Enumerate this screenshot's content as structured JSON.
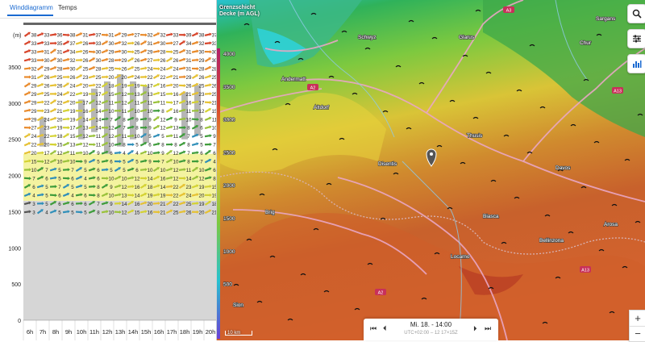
{
  "tabs": {
    "wind": "Winddiagramm",
    "temps": "Temps"
  },
  "unit": "(m)",
  "y_ticks": [
    "3500",
    "3000",
    "2500",
    "2000",
    "1500",
    "1000",
    "500",
    "0"
  ],
  "hours": [
    "6h",
    "7h",
    "8h",
    "9h",
    "10h",
    "11h",
    "12h",
    "13h",
    "14h",
    "15h",
    "16h",
    "17h",
    "18h",
    "19h",
    "20h"
  ],
  "rows": [
    [
      "38",
      "33",
      "36",
      "38",
      "31",
      "37",
      "31",
      "29",
      "27",
      "32",
      "32",
      "33",
      "39",
      "38",
      "37"
    ],
    [
      "33",
      "33",
      "35",
      "37",
      "26",
      "33",
      "30",
      "32",
      "26",
      "31",
      "30",
      "27",
      "34",
      "32",
      "33"
    ],
    [
      "33",
      "31",
      "31",
      "34",
      "26",
      "30",
      "29",
      "30",
      "25",
      "29",
      "28",
      "25",
      "31",
      "30",
      "30"
    ],
    [
      "33",
      "30",
      "30",
      "32",
      "26",
      "30",
      "28",
      "29",
      "26",
      "27",
      "26",
      "26",
      "31",
      "29",
      "30"
    ],
    [
      "32",
      "29",
      "28",
      "30",
      "25",
      "28",
      "25",
      "26",
      "25",
      "24",
      "24",
      "24",
      "31",
      "28",
      "28"
    ],
    [
      "31",
      "26",
      "25",
      "26",
      "23",
      "25",
      "20",
      "20",
      "24",
      "22",
      "22",
      "21",
      "29",
      "26",
      "25"
    ],
    [
      "29",
      "26",
      "26",
      "24",
      "20",
      "22",
      "18",
      "19",
      "19",
      "17",
      "16",
      "20",
      "26",
      "25",
      "26"
    ],
    [
      "29",
      "25",
      "24",
      "22",
      "19",
      "17",
      "15",
      "12",
      "13",
      "13",
      "15",
      "16",
      "21",
      "23",
      "25"
    ],
    [
      "29",
      "22",
      "22",
      "20",
      "17",
      "12",
      "11",
      "12",
      "11",
      "11",
      "11",
      "17",
      "16",
      "17",
      "21"
    ],
    [
      "29",
      "23",
      "21",
      "19",
      "16",
      "14",
      "10",
      "11",
      "10",
      "10",
      "8",
      "16",
      "11",
      "12",
      "15"
    ],
    [
      "29",
      "24",
      "20",
      "19",
      "14",
      "14",
      "7",
      "8",
      "9",
      "9",
      "12",
      "9",
      "10",
      "8",
      "11"
    ],
    [
      "27",
      "23",
      "19",
      "17",
      "13",
      "14",
      "12",
      "7",
      "8",
      "9",
      "12",
      "13",
      "8",
      "6",
      "10"
    ],
    [
      "24",
      "22",
      "18",
      "15",
      "12",
      "11",
      "12",
      "11",
      "10",
      "5",
      "5",
      "11",
      "7",
      "5",
      "9"
    ],
    [
      "22",
      "20",
      "15",
      "13",
      "12",
      "11",
      "10",
      "8",
      "5",
      "6",
      "8",
      "8",
      "8",
      "5",
      "7"
    ],
    [
      "20",
      "17",
      "12",
      "11",
      "10",
      "9",
      "6",
      "4",
      "4",
      "10",
      "9",
      "12",
      "7",
      "6",
      "6"
    ],
    [
      "15",
      "12",
      "10",
      "10",
      "9",
      "5",
      "6",
      "5",
      "5",
      "9",
      "7",
      "10",
      "8",
      "7",
      "4"
    ],
    [
      "10",
      "7",
      "5",
      "7",
      "5",
      "6",
      "5",
      "5",
      "6",
      "10",
      "10",
      "12",
      "11",
      "10",
      "6"
    ],
    [
      "7",
      "6",
      "5",
      "6",
      "4",
      "6",
      "10",
      "10",
      "12",
      "14",
      "16",
      "12",
      "14",
      "12",
      "8"
    ],
    [
      "6",
      "5",
      "7",
      "5",
      "5",
      "8",
      "9",
      "12",
      "16",
      "18",
      "14",
      "22",
      "23",
      "19",
      "15"
    ],
    [
      "4",
      "5",
      "6",
      "4",
      "6",
      "8",
      "10",
      "13",
      "14",
      "19",
      "19",
      "22",
      "24",
      "20",
      "19"
    ],
    [
      "3",
      "5",
      "6",
      "6",
      "6",
      "7",
      "9",
      "14",
      "16",
      "20",
      "21",
      "22",
      "25",
      "19",
      "18"
    ],
    [
      "3",
      "4",
      "5",
      "5",
      "5",
      "8",
      "10",
      "12",
      "15",
      "16",
      "21",
      "25",
      "26",
      "20",
      "21"
    ]
  ],
  "map": {
    "legend": "Grenzschicht Decke (m AGL)",
    "colorbar_ticks": [
      "4000",
      "3500",
      "3000",
      "2500",
      "2000",
      "1500",
      "1000",
      "500"
    ],
    "places": [
      {
        "name": "Schwyz"
      },
      {
        "name": "Glarus"
      },
      {
        "name": "Altdorf"
      },
      {
        "name": "Chur"
      },
      {
        "name": "Disentis"
      },
      {
        "name": "Andermatt"
      },
      {
        "name": "Thusis"
      },
      {
        "name": "Davos"
      },
      {
        "name": "Biasca"
      },
      {
        "name": "Bellinzona"
      },
      {
        "name": "Locarno"
      },
      {
        "name": "Brig"
      },
      {
        "name": "Sion"
      },
      {
        "name": "Sargans"
      },
      {
        "name": "Arosa"
      }
    ],
    "roads": [
      "A3",
      "A2",
      "A13",
      "A2",
      "A13"
    ],
    "time": "Mi. 18. - 14:00",
    "time_sub": "UTC+02:00 – 12 17×15Z",
    "scale": "10 km",
    "zoom_in": "+",
    "zoom_out": "−"
  },
  "icons": {
    "search": "search-icon",
    "settings": "sliders-icon",
    "chart": "bar-chart-icon",
    "marker": "location-pin-icon"
  }
}
